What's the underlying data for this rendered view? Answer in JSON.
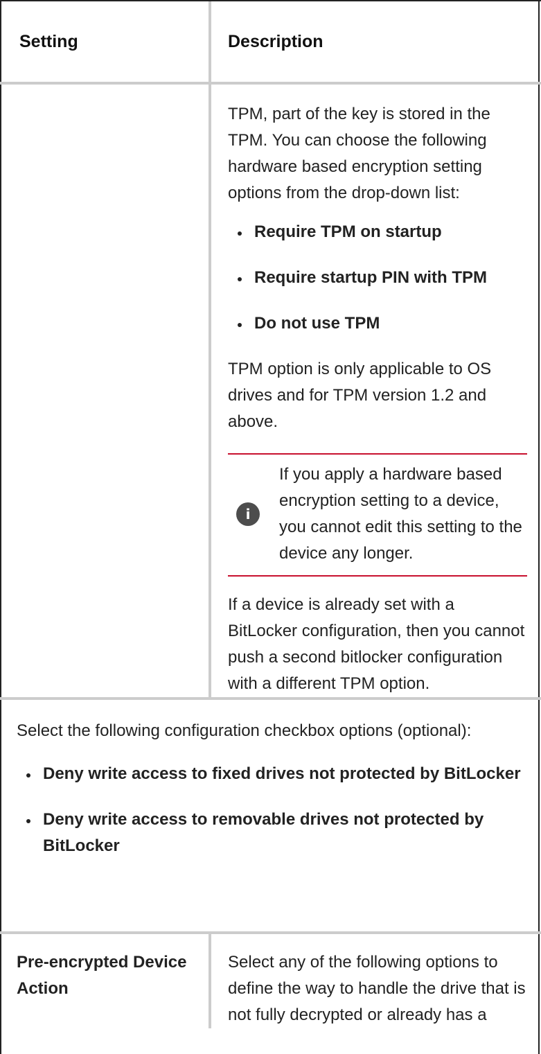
{
  "header": {
    "setting": "Setting",
    "description": "Description"
  },
  "row1": {
    "intro": "TPM, part of the key is stored in the TPM. You can choose the following hardware based encryption setting options from the drop-down list:",
    "options": [
      "Require TPM on startup",
      "Require startup PIN with TPM",
      "Do not use TPM"
    ],
    "tpm_note": "TPM option is only applicable to OS drives and for TPM version 1.2 and above.",
    "callout": {
      "icon": "info-icon",
      "icon_glyph": "i",
      "text": "If you apply a hardware based encryption setting to a device, you cannot edit this setting to the device any longer."
    },
    "bitlocker_note": "If a device is already set with a BitLocker configuration, then you cannot push a second bitlocker configuration with a different TPM option."
  },
  "row2": {
    "intro": "Select the following configuration checkbox options (optional):",
    "options": [
      "Deny write access to fixed drives not protected by BitLocker",
      "Deny write access to removable drives not protected by BitLocker"
    ]
  },
  "row3": {
    "setting": "Pre-encrypted Device Action",
    "description": "Select any of the following options to define the way to handle the drive that is not fully decrypted or already has a"
  },
  "colors": {
    "border": "#cccccc",
    "frame": "#222222",
    "callout_rule": "#c8102e",
    "info_icon_bg": "#4d4d4d"
  }
}
